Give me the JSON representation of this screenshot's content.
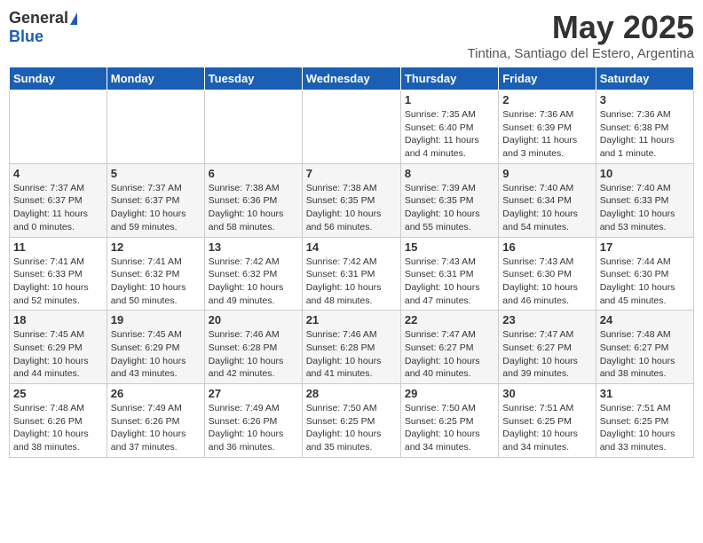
{
  "header": {
    "logo_general": "General",
    "logo_blue": "Blue",
    "title": "May 2025",
    "location": "Tintina, Santiago del Estero, Argentina"
  },
  "weekdays": [
    "Sunday",
    "Monday",
    "Tuesday",
    "Wednesday",
    "Thursday",
    "Friday",
    "Saturday"
  ],
  "weeks": [
    [
      {
        "day": "",
        "info": ""
      },
      {
        "day": "",
        "info": ""
      },
      {
        "day": "",
        "info": ""
      },
      {
        "day": "",
        "info": ""
      },
      {
        "day": "1",
        "info": "Sunrise: 7:35 AM\nSunset: 6:40 PM\nDaylight: 11 hours\nand 4 minutes."
      },
      {
        "day": "2",
        "info": "Sunrise: 7:36 AM\nSunset: 6:39 PM\nDaylight: 11 hours\nand 3 minutes."
      },
      {
        "day": "3",
        "info": "Sunrise: 7:36 AM\nSunset: 6:38 PM\nDaylight: 11 hours\nand 1 minute."
      }
    ],
    [
      {
        "day": "4",
        "info": "Sunrise: 7:37 AM\nSunset: 6:37 PM\nDaylight: 11 hours\nand 0 minutes."
      },
      {
        "day": "5",
        "info": "Sunrise: 7:37 AM\nSunset: 6:37 PM\nDaylight: 10 hours\nand 59 minutes."
      },
      {
        "day": "6",
        "info": "Sunrise: 7:38 AM\nSunset: 6:36 PM\nDaylight: 10 hours\nand 58 minutes."
      },
      {
        "day": "7",
        "info": "Sunrise: 7:38 AM\nSunset: 6:35 PM\nDaylight: 10 hours\nand 56 minutes."
      },
      {
        "day": "8",
        "info": "Sunrise: 7:39 AM\nSunset: 6:35 PM\nDaylight: 10 hours\nand 55 minutes."
      },
      {
        "day": "9",
        "info": "Sunrise: 7:40 AM\nSunset: 6:34 PM\nDaylight: 10 hours\nand 54 minutes."
      },
      {
        "day": "10",
        "info": "Sunrise: 7:40 AM\nSunset: 6:33 PM\nDaylight: 10 hours\nand 53 minutes."
      }
    ],
    [
      {
        "day": "11",
        "info": "Sunrise: 7:41 AM\nSunset: 6:33 PM\nDaylight: 10 hours\nand 52 minutes."
      },
      {
        "day": "12",
        "info": "Sunrise: 7:41 AM\nSunset: 6:32 PM\nDaylight: 10 hours\nand 50 minutes."
      },
      {
        "day": "13",
        "info": "Sunrise: 7:42 AM\nSunset: 6:32 PM\nDaylight: 10 hours\nand 49 minutes."
      },
      {
        "day": "14",
        "info": "Sunrise: 7:42 AM\nSunset: 6:31 PM\nDaylight: 10 hours\nand 48 minutes."
      },
      {
        "day": "15",
        "info": "Sunrise: 7:43 AM\nSunset: 6:31 PM\nDaylight: 10 hours\nand 47 minutes."
      },
      {
        "day": "16",
        "info": "Sunrise: 7:43 AM\nSunset: 6:30 PM\nDaylight: 10 hours\nand 46 minutes."
      },
      {
        "day": "17",
        "info": "Sunrise: 7:44 AM\nSunset: 6:30 PM\nDaylight: 10 hours\nand 45 minutes."
      }
    ],
    [
      {
        "day": "18",
        "info": "Sunrise: 7:45 AM\nSunset: 6:29 PM\nDaylight: 10 hours\nand 44 minutes."
      },
      {
        "day": "19",
        "info": "Sunrise: 7:45 AM\nSunset: 6:29 PM\nDaylight: 10 hours\nand 43 minutes."
      },
      {
        "day": "20",
        "info": "Sunrise: 7:46 AM\nSunset: 6:28 PM\nDaylight: 10 hours\nand 42 minutes."
      },
      {
        "day": "21",
        "info": "Sunrise: 7:46 AM\nSunset: 6:28 PM\nDaylight: 10 hours\nand 41 minutes."
      },
      {
        "day": "22",
        "info": "Sunrise: 7:47 AM\nSunset: 6:27 PM\nDaylight: 10 hours\nand 40 minutes."
      },
      {
        "day": "23",
        "info": "Sunrise: 7:47 AM\nSunset: 6:27 PM\nDaylight: 10 hours\nand 39 minutes."
      },
      {
        "day": "24",
        "info": "Sunrise: 7:48 AM\nSunset: 6:27 PM\nDaylight: 10 hours\nand 38 minutes."
      }
    ],
    [
      {
        "day": "25",
        "info": "Sunrise: 7:48 AM\nSunset: 6:26 PM\nDaylight: 10 hours\nand 38 minutes."
      },
      {
        "day": "26",
        "info": "Sunrise: 7:49 AM\nSunset: 6:26 PM\nDaylight: 10 hours\nand 37 minutes."
      },
      {
        "day": "27",
        "info": "Sunrise: 7:49 AM\nSunset: 6:26 PM\nDaylight: 10 hours\nand 36 minutes."
      },
      {
        "day": "28",
        "info": "Sunrise: 7:50 AM\nSunset: 6:25 PM\nDaylight: 10 hours\nand 35 minutes."
      },
      {
        "day": "29",
        "info": "Sunrise: 7:50 AM\nSunset: 6:25 PM\nDaylight: 10 hours\nand 34 minutes."
      },
      {
        "day": "30",
        "info": "Sunrise: 7:51 AM\nSunset: 6:25 PM\nDaylight: 10 hours\nand 34 minutes."
      },
      {
        "day": "31",
        "info": "Sunrise: 7:51 AM\nSunset: 6:25 PM\nDaylight: 10 hours\nand 33 minutes."
      }
    ]
  ]
}
